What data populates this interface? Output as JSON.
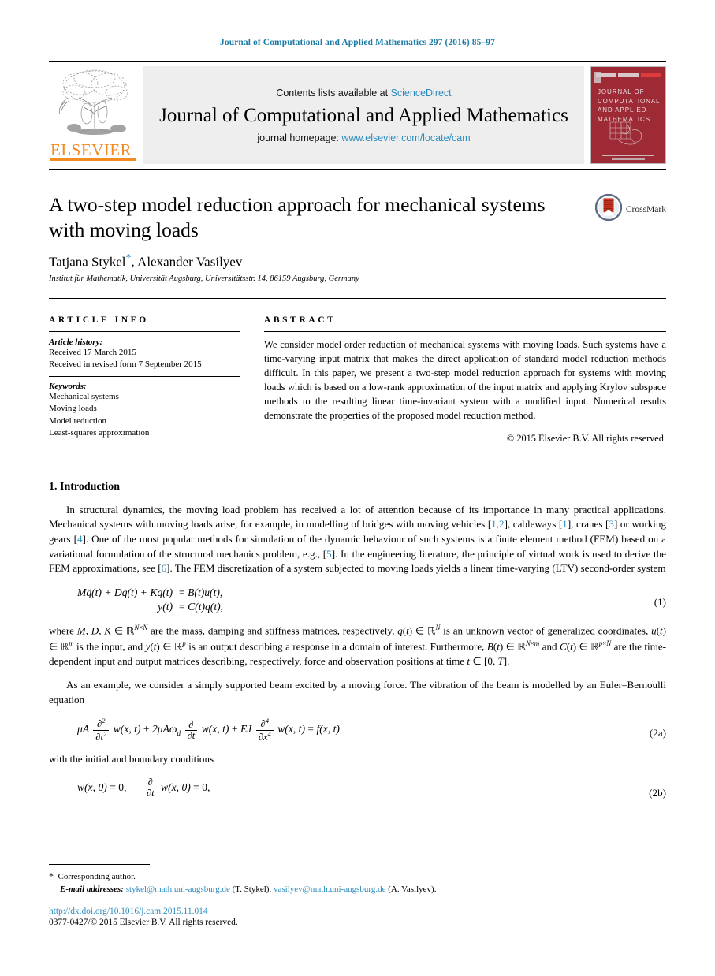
{
  "running_head": "Journal of Computational and Applied Mathematics 297 (2016) 85–97",
  "banner": {
    "contents_prefix": "Contents lists available at ",
    "contents_link": "ScienceDirect",
    "journal_title": "Journal of Computational and Applied Mathematics",
    "homepage_prefix": "journal homepage: ",
    "homepage_link": "www.elsevier.com/locate/cam",
    "publisher_wordmark": "ELSEVIER",
    "cover_title": "JOURNAL OF COMPUTATIONAL AND APPLIED MATHEMATICS",
    "link_color": "#2b8cbe",
    "elsevier_orange": "#F28B22",
    "cover_red": "#9e2a35"
  },
  "article": {
    "title": "A two-step model reduction approach for mechanical systems with moving loads",
    "authors": "Tatjana Stykel",
    "author_star": "*",
    "authors_rest": ", Alexander Vasilyev",
    "affiliation": "Institut für Mathematik, Universität Augsburg, Universitätsstr. 14, 86159 Augsburg, Germany",
    "crossmark_label": "CrossMark"
  },
  "info": {
    "label": "ARTICLE INFO",
    "history_heading": "Article history:",
    "history": [
      "Received 17 March 2015",
      "Received in revised form 7 September 2015"
    ],
    "keywords_heading": "Keywords:",
    "keywords": [
      "Mechanical systems",
      "Moving loads",
      "Model reduction",
      "Least-squares approximation"
    ]
  },
  "abstract": {
    "label": "ABSTRACT",
    "text": "We consider model order reduction of mechanical systems with moving loads. Such systems have a time-varying input matrix that makes the direct application of standard model reduction methods difficult. In this paper, we present a two-step model reduction approach for systems with moving loads which is based on a low-rank approximation of the input matrix and applying Krylov subspace methods to the resulting linear time-invariant system with a modified input. Numerical results demonstrate the properties of the proposed model reduction method.",
    "copyright": "© 2015 Elsevier B.V. All rights reserved."
  },
  "body": {
    "section_number": "1.",
    "section_title": "Introduction",
    "para1_a": "In structural dynamics, the moving load problem has received a lot of attention because of its importance in many practical applications. Mechanical systems with moving loads arise, for example, in modelling of bridges with moving vehicles [",
    "ref_12": "1,2",
    "para1_b": "], cableways [",
    "ref_1": "1",
    "para1_c": "], cranes [",
    "ref_3": "3",
    "para1_d": "] or working gears [",
    "ref_4": "4",
    "para1_e": "]. One of the most popular methods for simulation of the dynamic behaviour of such systems is a finite element method (FEM) based on a variational formulation of the structural mechanics problem, e.g., [",
    "ref_5": "5",
    "para1_f": "]. In the engineering literature, the principle of virtual work is used to derive the FEM approximations, see [",
    "ref_6": "6",
    "para1_g": "]. The FEM discretization of a system subjected to moving loads yields a linear time-varying (LTV) second-order system",
    "eq1_line1_lhs": "Mq̈(t) + Dq̇(t) + Kq(t)",
    "eq1_line1_rhs": "B(t)u(t),",
    "eq1_line2_lhs": "y(t)",
    "eq1_line2_rhs": "C(t)q(t),",
    "eq1_number": "(1)",
    "para2": "where M, D, K ∈ ℝ^{N×N} are the mass, damping and stiffness matrices, respectively, q(t) ∈ ℝ^N is an unknown vector of generalized coordinates, u(t) ∈ ℝ^m is the input, and y(t) ∈ ℝ^p is an output describing a response in a domain of interest. Furthermore, B(t) ∈ ℝ^{N×m} and C(t) ∈ ℝ^{p×N} are the time-dependent input and output matrices describing, respectively, force and observation positions at time t ∈ [0, T].",
    "para3": "As an example, we consider a simply supported beam excited by a moving force. The vibration of the beam is modelled by an Euler–Bernoulli equation",
    "eq2a_number": "(2a)",
    "para4": "with the initial and boundary conditions",
    "eq2b_number": "(2b)"
  },
  "footnotes": {
    "star": "*",
    "corresponding": "Corresponding author.",
    "email_label": "E-mail addresses:",
    "email1": "stykel@math.uni-augsburg.de",
    "email1_who": "(T. Stykel),",
    "email2": "vasilyev@math.uni-augsburg.de",
    "email2_who": "(A. Vasilyev).",
    "doi": "http://dx.doi.org/10.1016/j.cam.2015.11.014",
    "issn": "0377-0427/© 2015 Elsevier B.V. All rights reserved."
  }
}
